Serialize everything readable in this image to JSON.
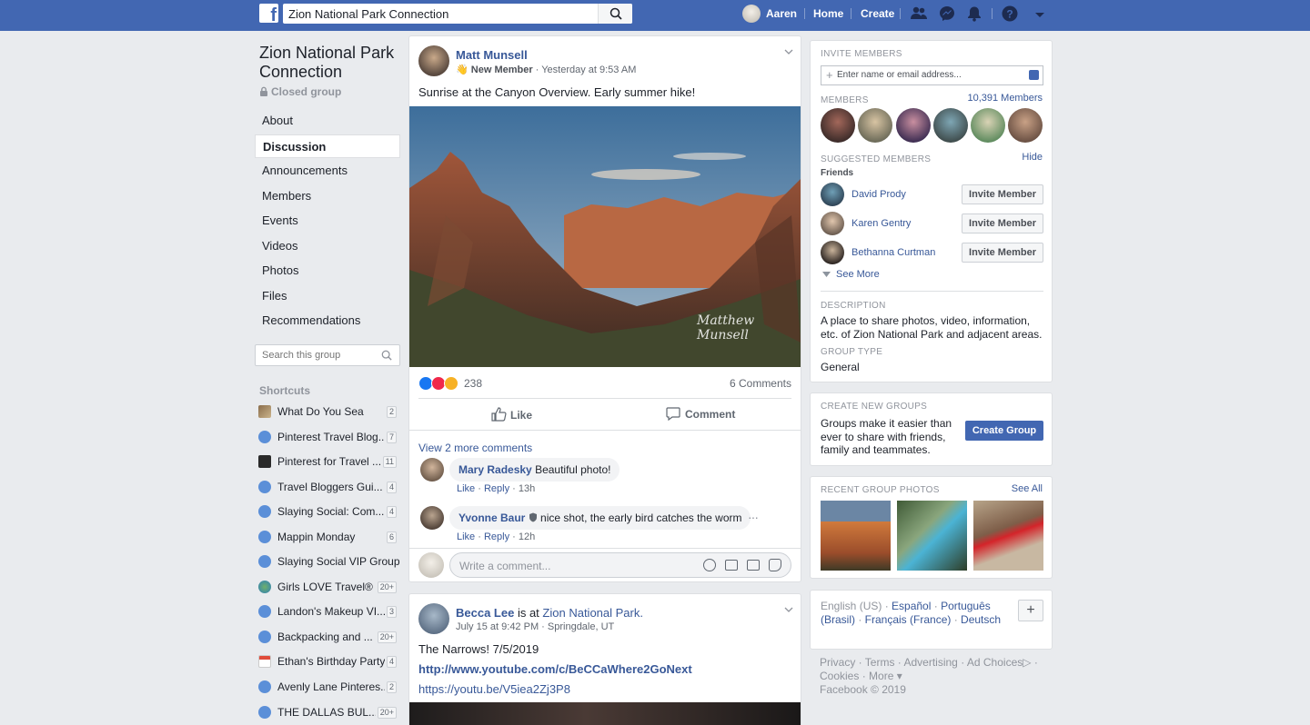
{
  "topbar": {
    "search_value": "Zion National Park Connection",
    "user_name": "Aaren",
    "home_label": "Home",
    "create_label": "Create"
  },
  "group": {
    "name": "Zion National Park Connection",
    "privacy": "Closed group",
    "nav": [
      {
        "label": "About"
      },
      {
        "label": "Discussion"
      },
      {
        "label": "Announcements"
      },
      {
        "label": "Members"
      },
      {
        "label": "Events"
      },
      {
        "label": "Videos"
      },
      {
        "label": "Photos"
      },
      {
        "label": "Files"
      },
      {
        "label": "Recommendations"
      }
    ],
    "search_placeholder": "Search this group"
  },
  "shortcuts": {
    "title": "Shortcuts",
    "items": [
      {
        "label": "What Do You Sea",
        "count": "2"
      },
      {
        "label": "Pinterest Travel Blog...",
        "count": "7"
      },
      {
        "label": "Pinterest for Travel ...",
        "count": "11"
      },
      {
        "label": "Travel Bloggers Gui...",
        "count": "4"
      },
      {
        "label": "Slaying Social: Com...",
        "count": "4"
      },
      {
        "label": "Mappin Monday",
        "count": "6"
      },
      {
        "label": "Slaying Social VIP Group",
        "count": ""
      },
      {
        "label": "Girls LOVE Travel®",
        "count": "20+"
      },
      {
        "label": "Landon's Makeup VI...",
        "count": "3"
      },
      {
        "label": "Backpacking and ...",
        "count": "20+"
      },
      {
        "label": "Ethan's Birthday Party ...",
        "count": "4"
      },
      {
        "label": "Avenly Lane Pinteres...",
        "count": "2"
      },
      {
        "label": "THE DALLAS BUL...",
        "count": "20+"
      }
    ]
  },
  "post1": {
    "author": "Matt Munsell",
    "badge": "New Member",
    "time": "Yesterday at 9:53 AM",
    "text": "Sunrise at the Canyon Overview. Early summer hike!",
    "watermark": "Matthew Munsell",
    "reaction_count": "238",
    "comments_count": "6 Comments",
    "like_label": "Like",
    "comment_label": "Comment",
    "view_more": "View 2 more comments",
    "comments": [
      {
        "name": "Mary Radesky",
        "text": "Beautiful photo!",
        "like": "Like",
        "reply": "Reply",
        "age": "13h"
      },
      {
        "name": "Yvonne Baur",
        "text": "nice shot, the early bird catches the worm",
        "like": "Like",
        "reply": "Reply",
        "age": "12h"
      }
    ],
    "comment_placeholder": "Write a comment..."
  },
  "post2": {
    "author": "Becca Lee",
    "is_at": "is at",
    "place": "Zion National Park.",
    "time": "July 15 at 9:42 PM",
    "location": "Springdale, UT",
    "text": "The Narrows!  7/5/2019",
    "link1": "http://www.youtube.com/c/BeCCaWhere2GoNext",
    "link2": "https://youtu.be/V5iea2Zj3P8"
  },
  "right": {
    "invite_title": "INVITE MEMBERS",
    "invite_placeholder": "Enter name or email address...",
    "members_title": "MEMBERS",
    "members_count": "10,391 Members",
    "suggested_title": "SUGGESTED MEMBERS",
    "hide_label": "Hide",
    "friends_label": "Friends",
    "suggested": [
      {
        "name": "David Prody",
        "button": "Invite Member"
      },
      {
        "name": "Karen Gentry",
        "button": "Invite Member"
      },
      {
        "name": "Bethanna Curtman",
        "button": "Invite Member"
      }
    ],
    "see_more": "See More",
    "description_title": "DESCRIPTION",
    "description": "A place to share photos, video, information, etc. of Zion National Park and adjacent areas.",
    "group_type_title": "GROUP TYPE",
    "group_type": "General",
    "create_title": "CREATE NEW GROUPS",
    "create_text": "Groups make it easier than ever to share with friends, family and teammates.",
    "create_button": "Create Group",
    "recent_title": "RECENT GROUP PHOTOS",
    "see_all": "See All"
  },
  "footer": {
    "lang_current": "English (US)",
    "languages": [
      "Español",
      "Português (Brasil)",
      "Français (France)",
      "Deutsch"
    ],
    "links": [
      "Privacy",
      "Terms",
      "Advertising",
      "Ad Choices",
      "Cookies",
      "More"
    ],
    "copyright": "Facebook © 2019"
  }
}
